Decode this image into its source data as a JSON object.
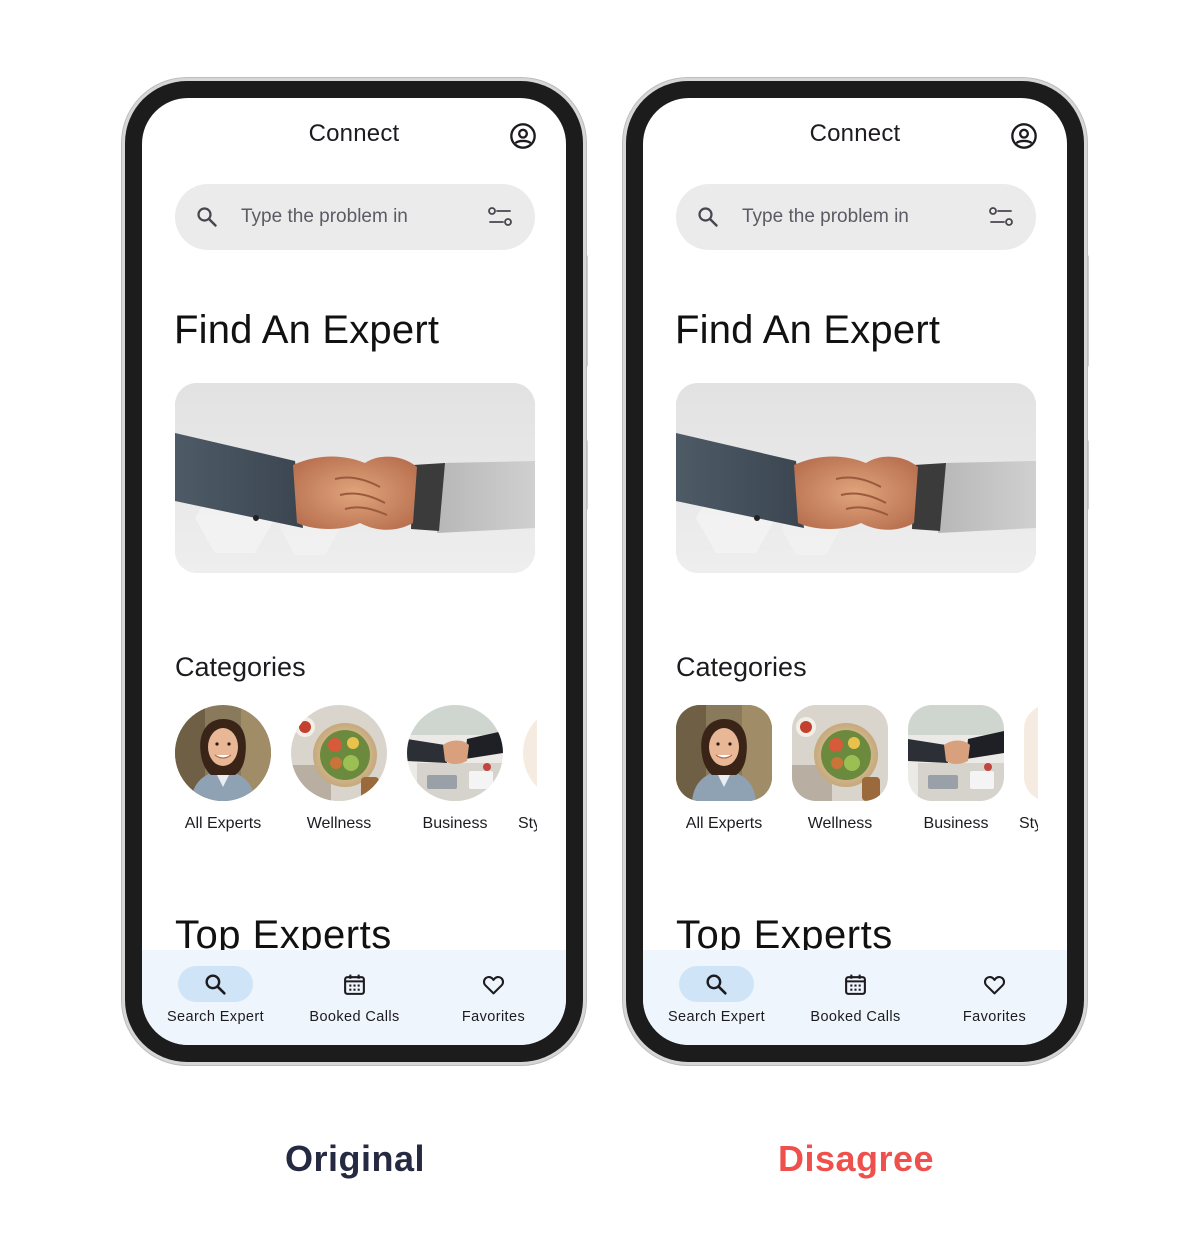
{
  "colors": {
    "original_caption": "#252a42",
    "disagree_caption": "#f0504c",
    "nav_active_pill": "#cfe5f7",
    "nav_background": "#eef5fc",
    "search_background": "#ebebeb"
  },
  "variants": [
    {
      "caption": "Original",
      "category_thumb_shape": "circle",
      "app": {
        "title": "Connect",
        "account_icon": "account-circle-icon",
        "search": {
          "placeholder": "Type the problem in",
          "search_icon": "search-icon",
          "filter_icon": "tune-icon"
        },
        "heading": "Find An Expert",
        "hero_image": "handshake-photo",
        "categories_title": "Categories",
        "categories": [
          {
            "label": "All Experts",
            "image": "woman-portrait"
          },
          {
            "label": "Wellness",
            "image": "salad-bowl"
          },
          {
            "label": "Business",
            "image": "business-handshake"
          },
          {
            "label": "Sty",
            "image": "partial"
          }
        ],
        "top_experts_title": "Top Experts",
        "nav": [
          {
            "label": "Search Expert",
            "icon": "search-icon",
            "active": true
          },
          {
            "label": "Booked Calls",
            "icon": "calendar-icon",
            "active": false
          },
          {
            "label": "Favorites",
            "icon": "heart-icon",
            "active": false
          }
        ]
      }
    },
    {
      "caption": "Disagree",
      "category_thumb_shape": "rounded-square",
      "app": {
        "title": "Connect",
        "account_icon": "account-circle-icon",
        "search": {
          "placeholder": "Type the problem in",
          "search_icon": "search-icon",
          "filter_icon": "tune-icon"
        },
        "heading": "Find An Expert",
        "hero_image": "handshake-photo",
        "categories_title": "Categories",
        "categories": [
          {
            "label": "All Experts",
            "image": "woman-portrait"
          },
          {
            "label": "Wellness",
            "image": "salad-bowl"
          },
          {
            "label": "Business",
            "image": "business-handshake"
          },
          {
            "label": "Sty",
            "image": "partial"
          }
        ],
        "top_experts_title": "Top Experts",
        "nav": [
          {
            "label": "Search Expert",
            "icon": "search-icon",
            "active": true
          },
          {
            "label": "Booked Calls",
            "icon": "calendar-icon",
            "active": false
          },
          {
            "label": "Favorites",
            "icon": "heart-icon",
            "active": false
          }
        ]
      }
    }
  ]
}
